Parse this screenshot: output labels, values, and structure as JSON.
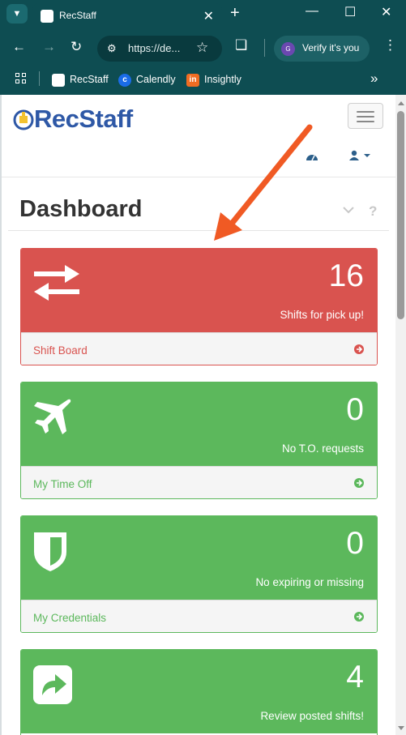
{
  "browser": {
    "tab_title": "RecStaff",
    "new_tab": "+",
    "url": "https://de...",
    "profile_button": "Verify it's you",
    "profile_initial": "G",
    "bookmarks": [
      {
        "label": "RecStaff"
      },
      {
        "label": "Calendly"
      },
      {
        "label": "Insightly"
      }
    ]
  },
  "app": {
    "brand": "RecStaff",
    "page_title": "Dashboard"
  },
  "panels": [
    {
      "count": "16",
      "caption": "Shifts for pick up!",
      "link": "Shift Board",
      "color": "#d9534f",
      "icon": "exchange-icon"
    },
    {
      "count": "0",
      "caption": "No T.O. requests",
      "link": "My Time Off",
      "color": "#5cb85c",
      "icon": "plane-icon"
    },
    {
      "count": "0",
      "caption": "No expiring or missing",
      "link": "My Credentials",
      "color": "#5cb85c",
      "icon": "shield-icon"
    },
    {
      "count": "4",
      "caption": "Review posted shifts!",
      "link": "",
      "color": "#5cb85c",
      "icon": "share-icon"
    }
  ],
  "annotation": {
    "arrow_color": "#f05a24"
  }
}
